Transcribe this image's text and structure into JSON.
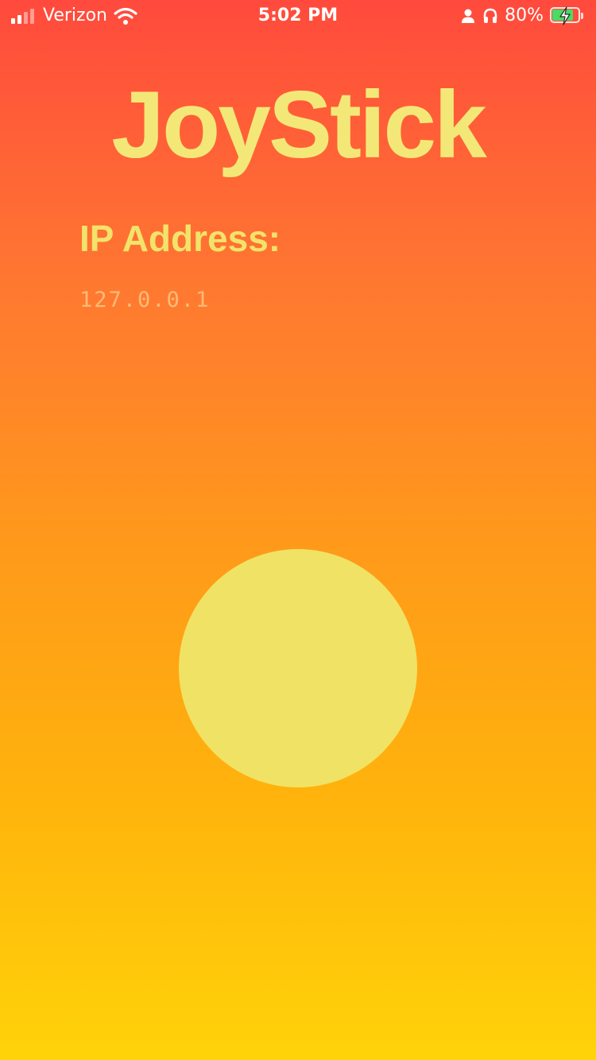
{
  "status_bar": {
    "carrier": "Verizon",
    "time": "5:02 PM",
    "battery_percent": "80%",
    "battery_level": 0.8,
    "icons": [
      "signal-icon",
      "wifi-icon",
      "person-icon",
      "headphones-icon",
      "battery-icon",
      "charging-bolt-icon"
    ]
  },
  "app": {
    "title": "JoyStick",
    "ip_label": "IP Address:",
    "ip_placeholder": "127.0.0.1"
  },
  "joystick": {
    "icon": "joystick-knob"
  },
  "colors": {
    "gradient_top": "#ff4a3d",
    "gradient_bottom": "#ffd30a",
    "title": "#f3e877",
    "knob": "#f0e265",
    "battery_fill": "#4cd964"
  }
}
